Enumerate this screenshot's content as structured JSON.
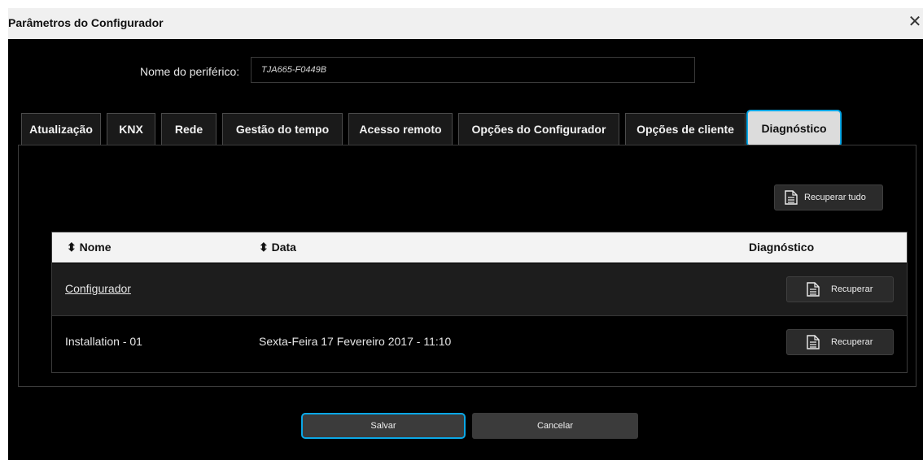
{
  "window": {
    "title": "Parâmetros do Configurador",
    "close_icon": "close-icon"
  },
  "peripheral": {
    "label": "Nome do periférico:",
    "value": "TJA665-F0449B"
  },
  "tabs": [
    {
      "label": "Atualização",
      "active": false
    },
    {
      "label": "KNX",
      "active": false
    },
    {
      "label": "Rede",
      "active": false
    },
    {
      "label": "Gestão do tempo",
      "active": false
    },
    {
      "label": "Acesso remoto",
      "active": false
    },
    {
      "label": "Opções do Configurador",
      "active": false
    },
    {
      "label": "Opções de cliente",
      "active": false
    },
    {
      "label": "Diagnóstico",
      "active": true
    }
  ],
  "diagnostics": {
    "retrieve_all_label": "Recuperar tudo",
    "columns": {
      "name": "Nome",
      "date": "Data",
      "diagnostic": "Diagnóstico"
    },
    "rows": [
      {
        "name": "Configurador",
        "date": "",
        "action": "Recuperar"
      },
      {
        "name": "Installation - 01",
        "date": "Sexta-Feira 17 Fevereiro 2017 - 11:10",
        "action": "Recuperar"
      }
    ]
  },
  "footer": {
    "save_label": "Salvar",
    "cancel_label": "Cancelar"
  },
  "colors": {
    "accent": "#0aa7e6",
    "background": "#000000",
    "header_bg": "#f3f3f3"
  }
}
